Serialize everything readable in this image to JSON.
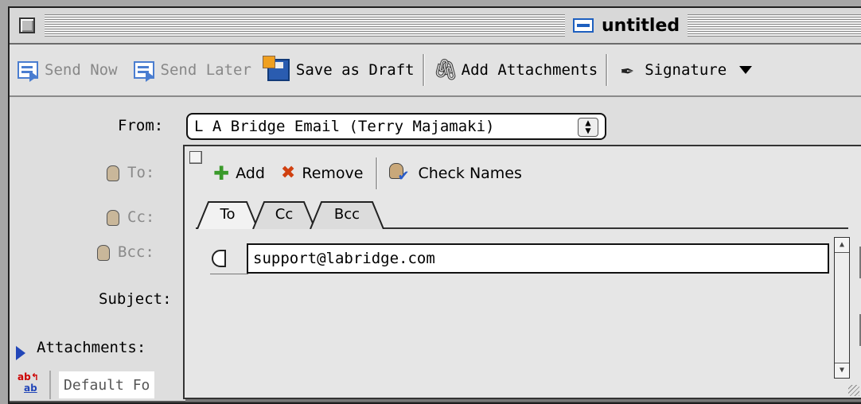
{
  "window": {
    "title": "untitled"
  },
  "toolbar": {
    "send_now": "Send Now",
    "send_later": "Send Later",
    "save_draft": "Save as Draft",
    "add_attachments": "Add Attachments",
    "signature": "Signature"
  },
  "form": {
    "from_label": "From:",
    "from_value": "L A Bridge Email (Terry Majamaki)",
    "to_label": "To:",
    "cc_label": "Cc:",
    "bcc_label": "Bcc:",
    "subject_label": "Subject:",
    "attachments_label": "Attachments:",
    "font_value": "Default Fo"
  },
  "popup": {
    "add": "Add",
    "remove": "Remove",
    "check_names": "Check Names",
    "tabs": [
      "To",
      "Cc",
      "Bcc"
    ],
    "active_tab": "To",
    "recipients": [
      "support@labridge.com"
    ]
  }
}
